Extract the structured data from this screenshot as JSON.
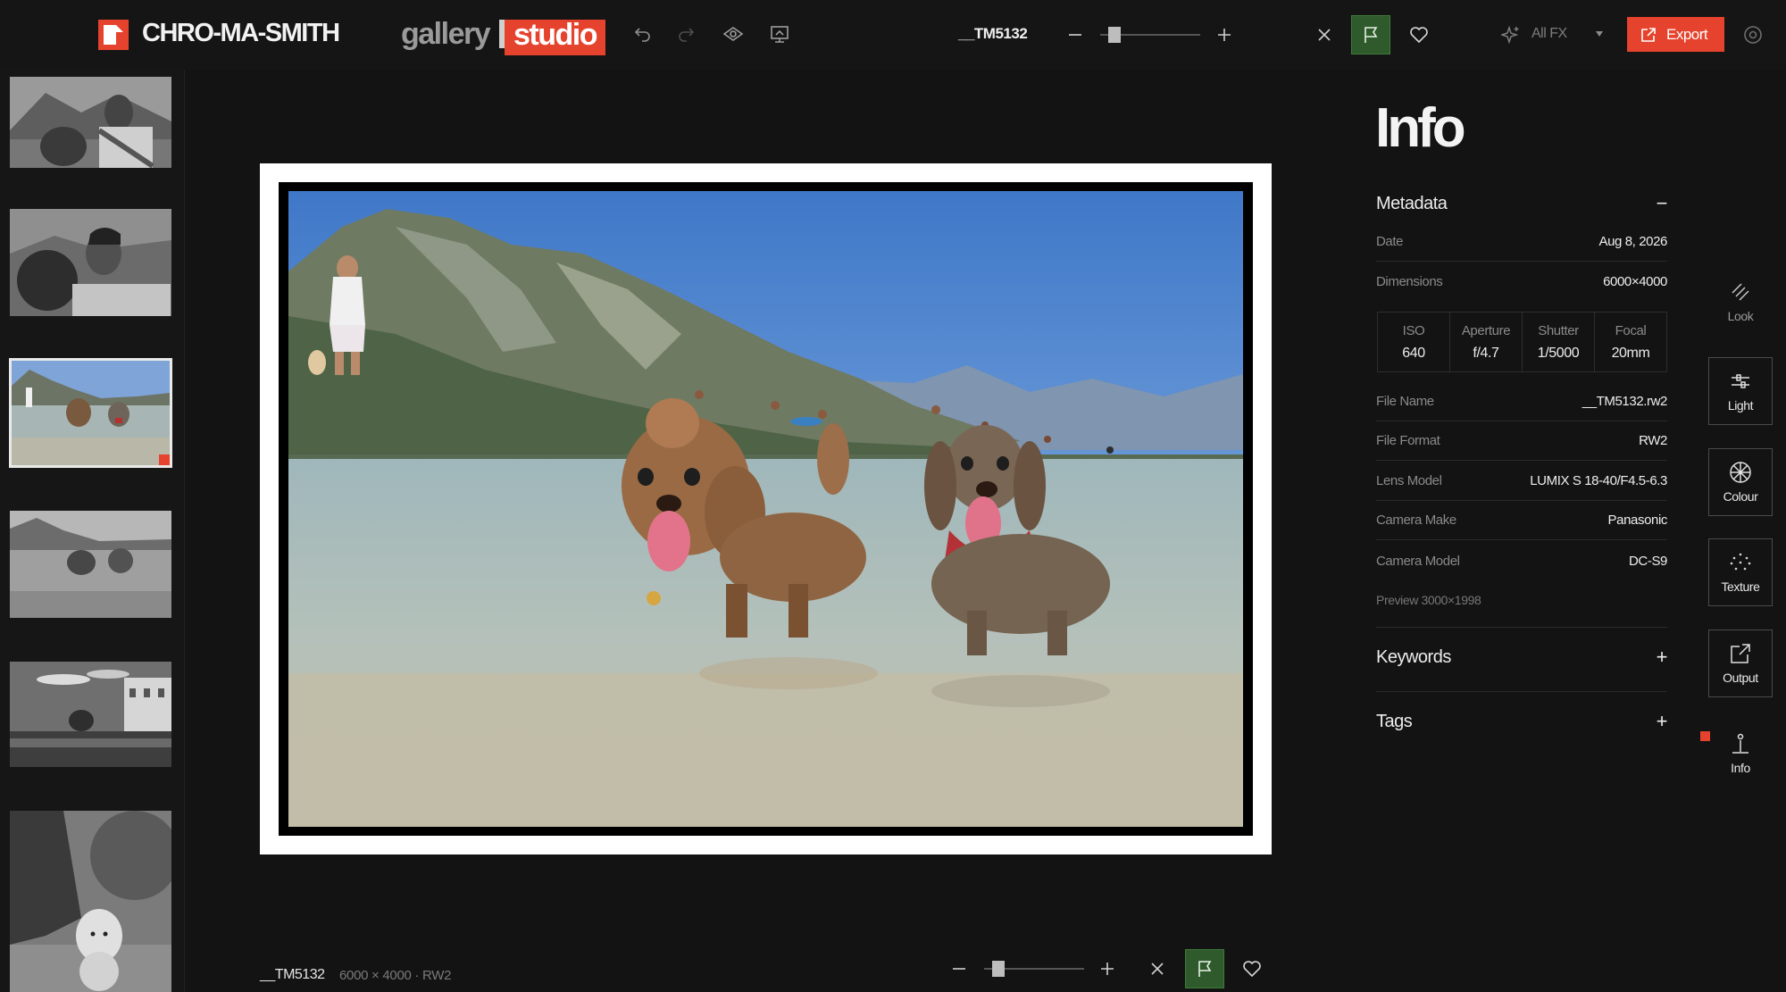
{
  "app": {
    "brand": "CHRO-MA-SMITH",
    "mode_gallery": "gallery",
    "mode_studio": "studio"
  },
  "toolbar": {
    "filename": "__TM5132",
    "allfx_label": "All FX",
    "export_label": "Export",
    "zoom_level": 0.12
  },
  "filmstrip": {
    "thumbnails": [
      {
        "name": "selfie-man-dog-mountains",
        "selected": false
      },
      {
        "name": "selfie-man-dog",
        "selected": false
      },
      {
        "name": "dogs-in-lake",
        "selected": true
      },
      {
        "name": "dogs-in-lake-bw",
        "selected": false
      },
      {
        "name": "field-house",
        "selected": false
      },
      {
        "name": "golden-retriever-tree",
        "selected": false
      }
    ]
  },
  "bottom": {
    "filename": "__TM5132",
    "meta": "6000 × 4000 · RW2",
    "zoom_level": 0.12
  },
  "info": {
    "title": "Info",
    "metadata_label": "Metadata",
    "metadata_toggle": "−",
    "date_label": "Date",
    "date_value": "Aug 8, 2026",
    "dimensions_label": "Dimensions",
    "dimensions_value": "6000×4000",
    "exif": [
      {
        "label": "ISO",
        "value": "640"
      },
      {
        "label": "Aperture",
        "value": "f/4.7"
      },
      {
        "label": "Shutter",
        "value": "1/5000"
      },
      {
        "label": "Focal",
        "value": "20mm"
      }
    ],
    "file_name_label": "File Name",
    "file_name_value": "__TM5132.rw2",
    "file_format_label": "File Format",
    "file_format_value": "RW2",
    "lens_label": "Lens Model",
    "lens_value": "LUMIX S 18-40/F4.5-6.3",
    "make_label": "Camera Make",
    "make_value": "Panasonic",
    "model_label": "Camera Model",
    "model_value": "DC-S9",
    "preview": "Preview 3000×1998",
    "keywords_label": "Keywords",
    "keywords_toggle": "+",
    "tags_label": "Tags",
    "tags_toggle": "+"
  },
  "rail": {
    "look": "Look",
    "light": "Light",
    "colour": "Colour",
    "texture": "Texture",
    "output": "Output",
    "info": "Info"
  },
  "colors": {
    "accent": "#e5432d",
    "flag_active": "#2f5a2c",
    "background": "#131313"
  },
  "icons": [
    "undo-icon",
    "redo-icon",
    "eye-icon",
    "compare-icon",
    "minus-icon",
    "plus-icon",
    "reject-icon",
    "flag-icon",
    "heart-icon",
    "sparkle-icon",
    "dropdown-icon",
    "export-icon",
    "settings-icon",
    "look-icon",
    "light-icon",
    "colour-icon",
    "texture-icon",
    "output-icon",
    "info-icon"
  ]
}
